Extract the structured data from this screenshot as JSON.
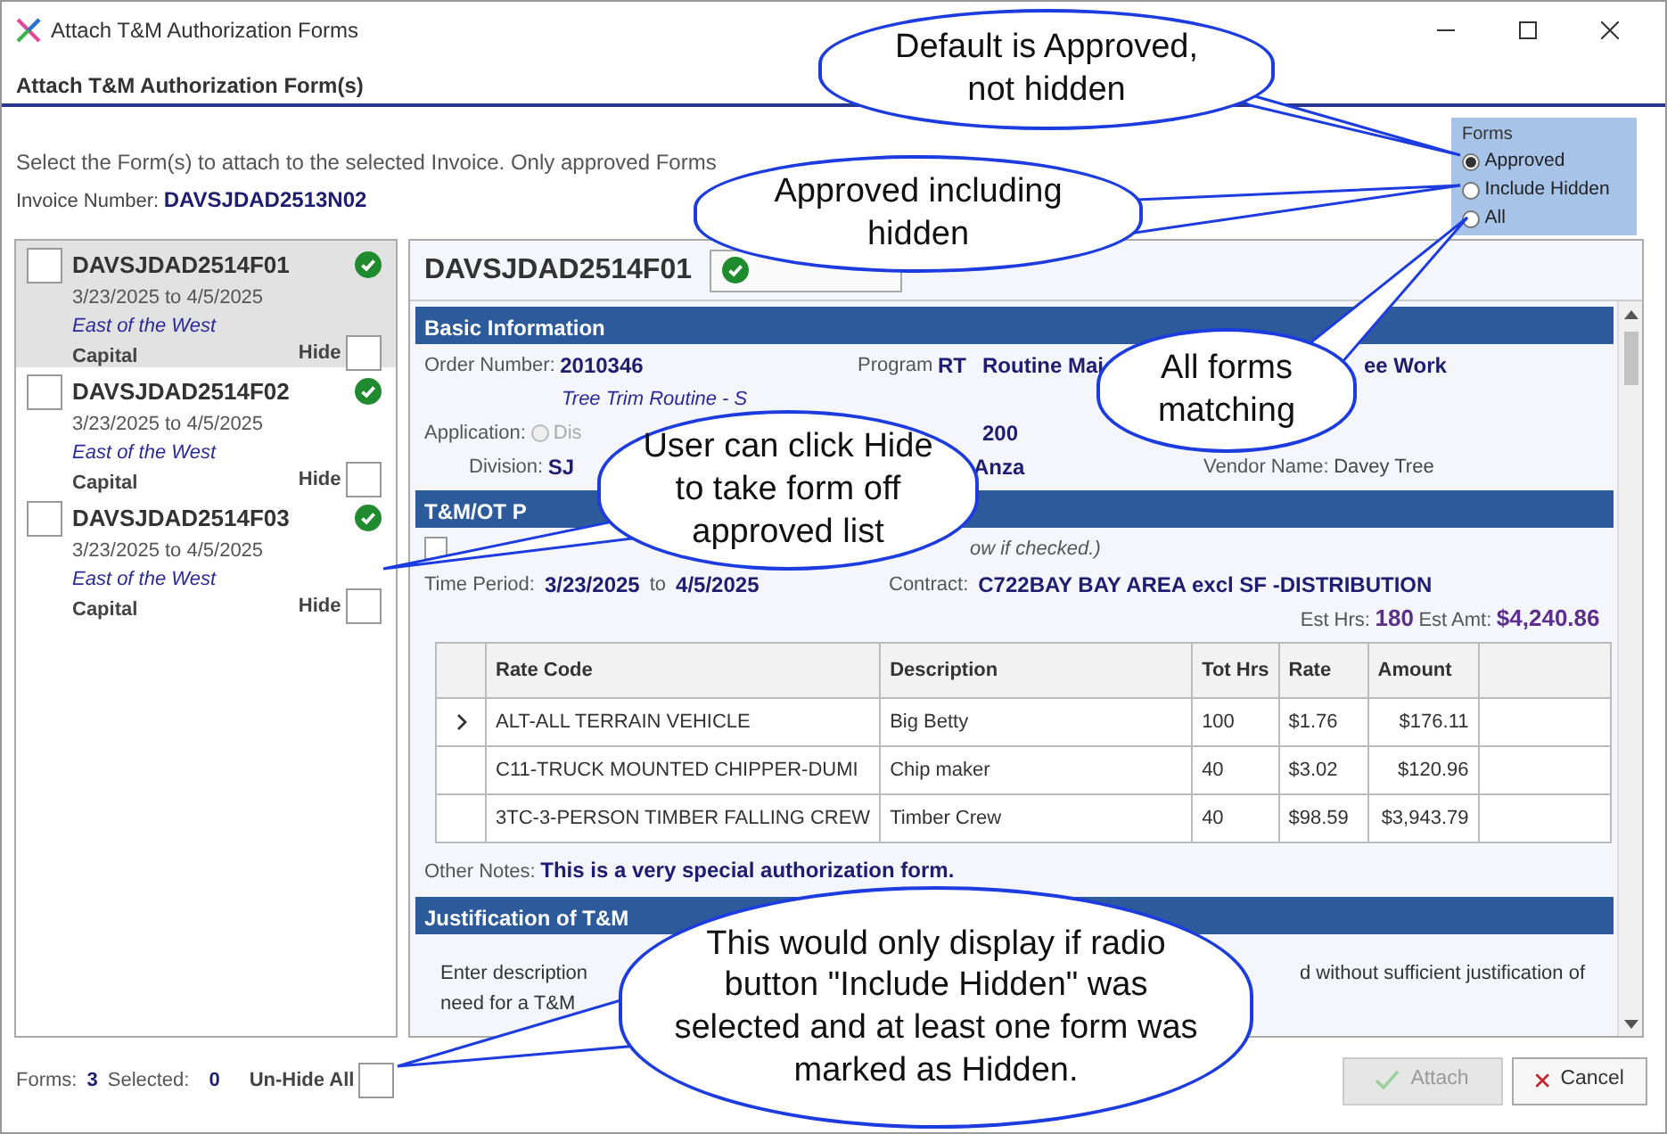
{
  "window": {
    "title": "Attach T&M Authorization Forms"
  },
  "header": {
    "title": "Attach T&M Authorization Form(s)"
  },
  "instructions": "Select the Form(s) to attach to the selected Invoice.  Only approved Forms",
  "invoice": {
    "label": "Invoice Number:",
    "value": "DAVSJDAD2513N02"
  },
  "forms_filter": {
    "legend": "Forms",
    "options": [
      {
        "label": "Approved",
        "selected": true
      },
      {
        "label": "Include Hidden",
        "selected": false
      },
      {
        "label": "All",
        "selected": false
      }
    ]
  },
  "form_list": [
    {
      "number": "DAVSJDAD2514F01",
      "dates": "3/23/2025  to  4/5/2025",
      "region": "East of the West",
      "category": "Capital",
      "checked": false,
      "approved": true,
      "hide_label": "Hide",
      "hidden": false,
      "selected": true
    },
    {
      "number": "DAVSJDAD2514F02",
      "dates": "3/23/2025  to  4/5/2025",
      "region": "East of the West",
      "category": "Capital",
      "checked": false,
      "approved": true,
      "hide_label": "Hide",
      "hidden": false,
      "selected": false
    },
    {
      "number": "DAVSJDAD2514F03",
      "dates": "3/23/2025  to  4/5/2025",
      "region": "East of the West",
      "category": "Capital",
      "checked": false,
      "approved": true,
      "hide_label": "Hide",
      "hidden": false,
      "selected": false
    }
  ],
  "detail": {
    "form_number": "DAVSJDAD2514F01",
    "approved": true,
    "basic_info": {
      "title": "Basic Information",
      "rows": [
        [
          {
            "label": "Order Number:",
            "value": "2010346"
          },
          {
            "label": "Program",
            "value": "RT"
          },
          {
            "value": "Routine Mai"
          },
          {
            "value": "ee Work"
          }
        ],
        [
          {
            "value": "Tree Trim Routine - S",
            "kind": "note"
          }
        ],
        [
          {
            "label": "Application:",
            "kind": "radio",
            "option": "Dis",
            "disabled": true
          },
          "",
          {
            "value": "200"
          }
        ],
        [
          {
            "label": "Division:",
            "value": "SJ"
          },
          "",
          {
            "value": "Anza"
          },
          {
            "label": "Vendor Name:",
            "value": "Davey Tree",
            "kind": "plain"
          }
        ]
      ]
    },
    "tm_section": {
      "title": "T&M/OT P",
      "overtime": {
        "checked": false,
        "note": "ow if checked.)"
      },
      "time_period": {
        "label": "Time Period:",
        "start": "3/23/2025",
        "to": "to",
        "end": "4/5/2025"
      },
      "contract": {
        "label": "Contract:",
        "value": "C722BAY BAY AREA excl SF -DISTRIBUTION"
      },
      "est_hrs": {
        "label": "Est Hrs:",
        "value": "180"
      },
      "est_amt": {
        "label": "Est Amt:",
        "value": "$4,240.86"
      },
      "table": {
        "columns": [
          "Rate Code",
          "Description",
          "Tot Hrs",
          "Rate",
          "Amount"
        ],
        "rows": [
          {
            "current": true,
            "cells": [
              "ALT-ALL TERRAIN VEHICLE",
              "Big Betty",
              "100",
              "$1.76",
              "$176.11"
            ]
          },
          {
            "current": false,
            "cells": [
              "C11-TRUCK MOUNTED CHIPPER-DUMI",
              "Chip maker",
              "40",
              "$3.02",
              "$120.96"
            ]
          },
          {
            "current": false,
            "cells": [
              "3TC-3-PERSON TIMBER FALLING CREW",
              "Timber Crew",
              "40",
              "$98.59",
              "$3,943.79"
            ]
          }
        ]
      },
      "other_notes": {
        "label": "Other Notes:",
        "value": "This is a very special authorization form."
      }
    },
    "justification": {
      "title": "Justification of T&M",
      "line_1_start": "Enter description",
      "line_1_end": "d without sufficient justification of",
      "line_2": "need for a T&M"
    }
  },
  "footer": {
    "forms_label": "Forms:",
    "forms_count": "3",
    "selected_label": "Selected:",
    "selected_count": "0",
    "unhide": {
      "label": "Un-Hide All",
      "checked": false
    }
  },
  "buttons": [
    {
      "label": "Attach",
      "kind": "attach",
      "disabled": true
    },
    {
      "label": "Cancel",
      "kind": "cancel",
      "disabled": false
    }
  ],
  "callouts": [
    {
      "text": "Default is Approved, not hidden"
    },
    {
      "text": "Approved including hidden"
    },
    {
      "text": "All forms matching"
    },
    {
      "text": "User can click Hide to take form off approved list"
    },
    {
      "text": "This would only display if radio button \"Include Hidden\" was selected and at least one form was marked as Hidden."
    }
  ]
}
